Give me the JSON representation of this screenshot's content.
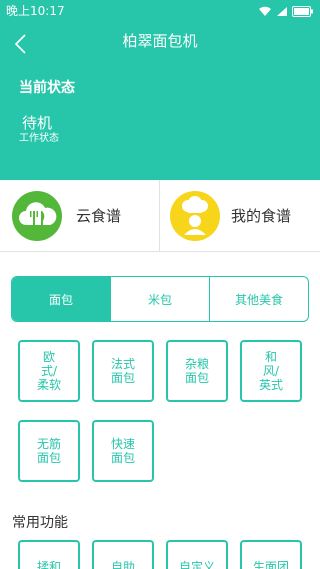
{
  "status_bar": {
    "time": "晚上10:17"
  },
  "header": {
    "title": "柏翠面包机",
    "state_heading": "当前状态",
    "state_value": "待机",
    "state_caption": "工作状态"
  },
  "cards": [
    {
      "label": "云食谱",
      "icon": "cloud-fork-knife-icon"
    },
    {
      "label": "我的食谱",
      "icon": "chef-icon"
    }
  ],
  "tabs": [
    {
      "label": "面包",
      "active": true
    },
    {
      "label": "米包",
      "active": false
    },
    {
      "label": "其他美食",
      "active": false
    }
  ],
  "modes": [
    {
      "label": "欧式/柔软"
    },
    {
      "label": "法式面包"
    },
    {
      "label": "杂粮面包"
    },
    {
      "label": "和风/英式"
    },
    {
      "label": "无筋面包"
    },
    {
      "label": "快速面包"
    }
  ],
  "common_functions": {
    "title": "常用功能",
    "items": [
      {
        "label": "揉和"
      },
      {
        "label": "自助"
      },
      {
        "label": "自定义"
      },
      {
        "label": "生面团"
      }
    ]
  },
  "colors": {
    "accent": "#27c6ab",
    "cloud_badge": "#53b83a",
    "chef_badge": "#f6d51b"
  }
}
